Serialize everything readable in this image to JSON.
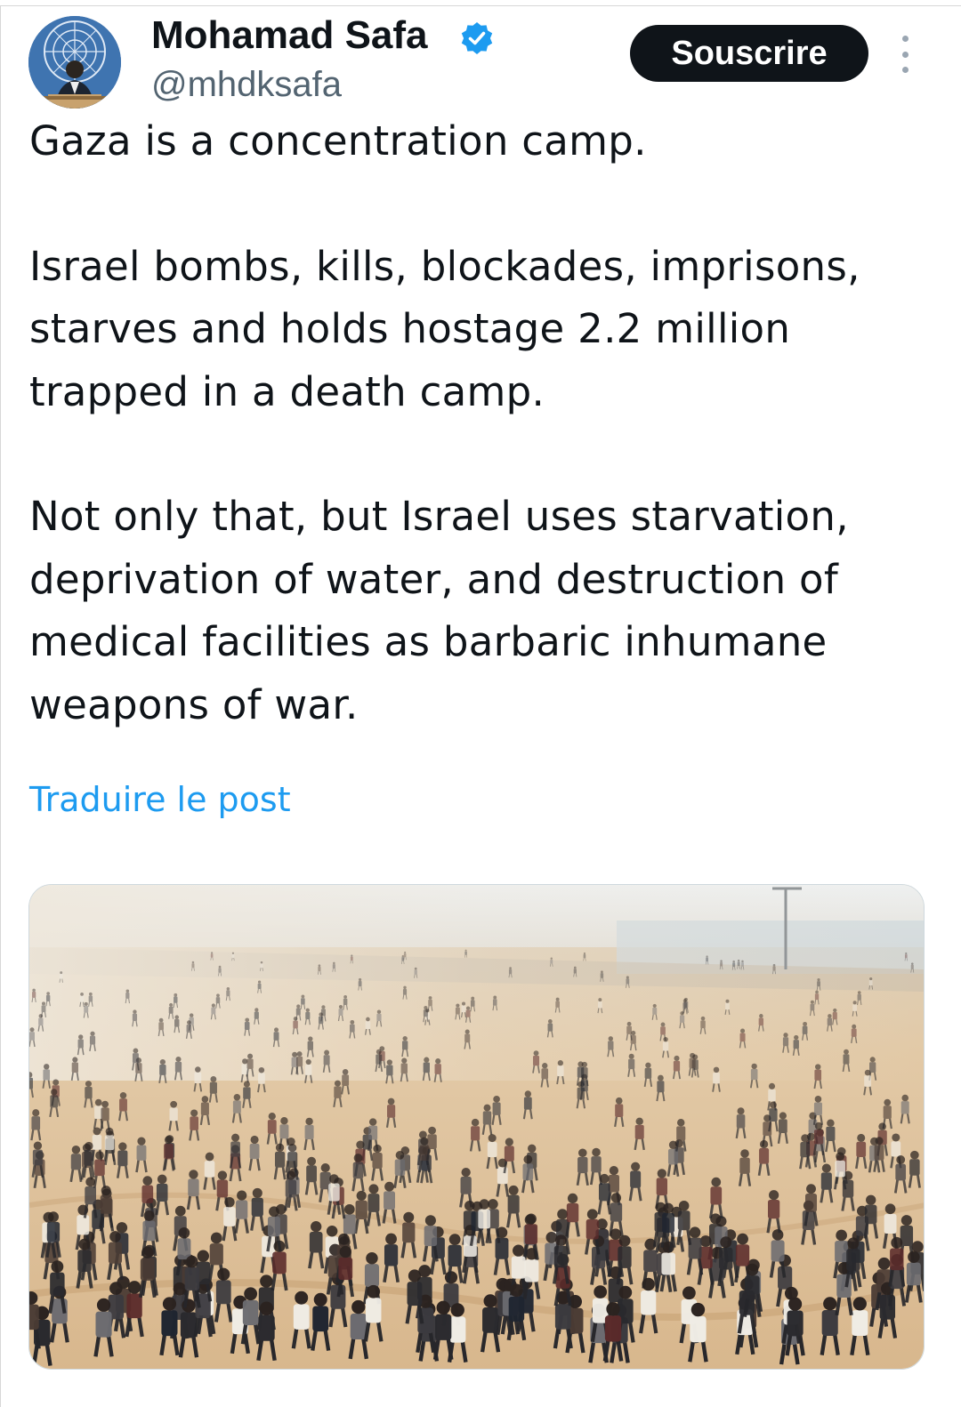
{
  "author": {
    "display_name": "Mohamad Safa",
    "handle": "@mhdksafa",
    "verified": true,
    "verified_color": "#1d9bf0"
  },
  "actions": {
    "subscribe_label": "Souscrire",
    "more_icon": "more-vertical-icon"
  },
  "post": {
    "paragraphs": [
      "Gaza is a concentration camp.",
      "Israel bombs, kills, blockades, imprisons, starves and holds hostage 2.2 million trapped in a death camp.",
      "Not only that, but Israel uses starvation, deprivation of water, and destruction of medical facilities as barbaric inhumane weapons of war."
    ],
    "translate_label": "Traduire le post"
  },
  "colors": {
    "text": "#0f1419",
    "secondary": "#536471",
    "link": "#1d9bf0",
    "button_bg": "#0f1419"
  }
}
